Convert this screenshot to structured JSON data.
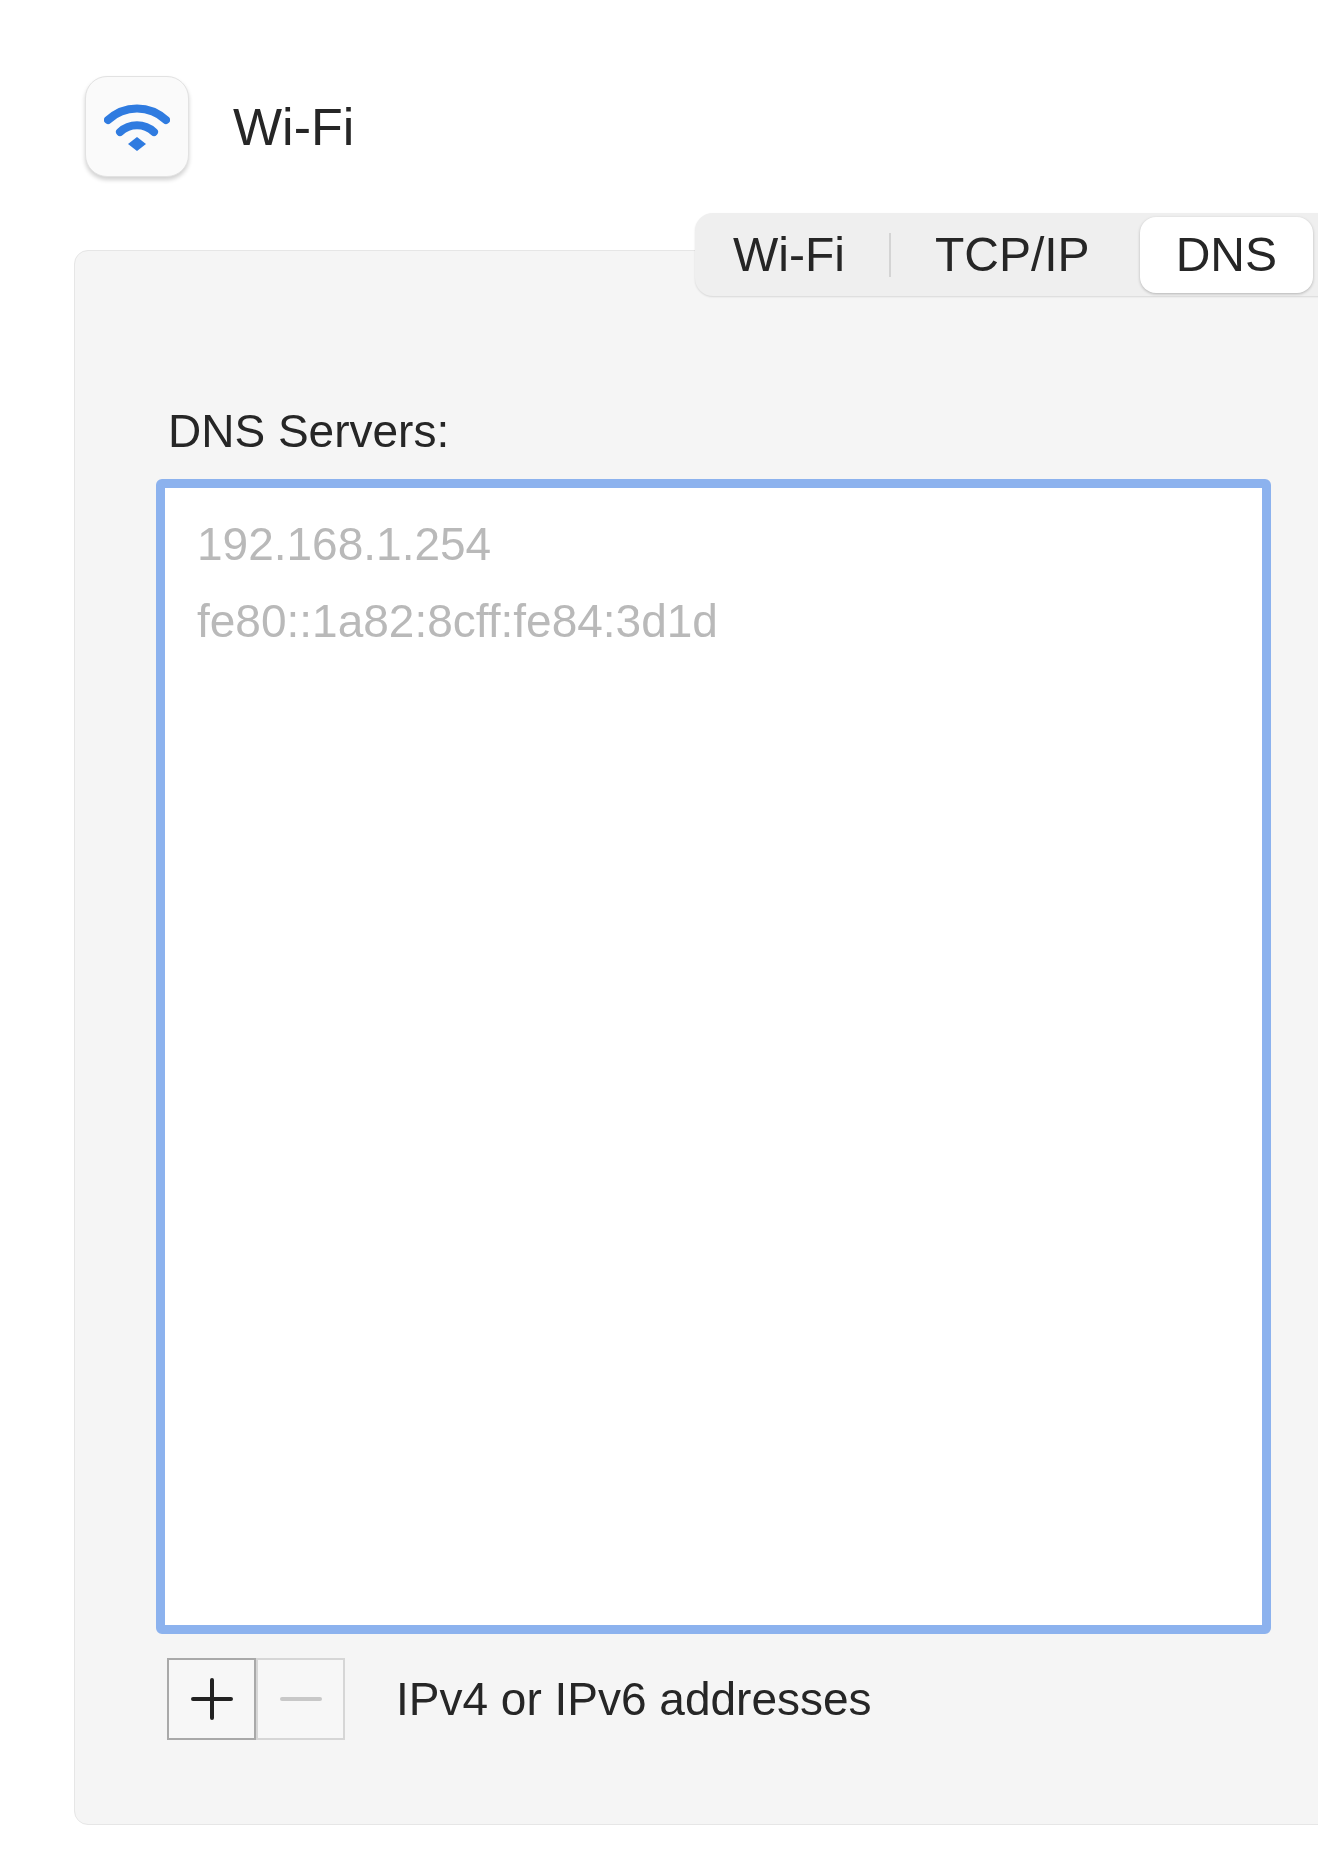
{
  "header": {
    "title": "Wi-Fi"
  },
  "tabs": [
    {
      "label": "Wi-Fi",
      "selected": false
    },
    {
      "label": "TCP/IP",
      "selected": false
    },
    {
      "label": "DNS",
      "selected": true
    }
  ],
  "dns_servers": {
    "label": "DNS Servers:",
    "focused": true,
    "entries": [
      "192.168.1.254",
      "fe80::1a82:8cff:fe84:3d1d"
    ]
  },
  "list_buttons": [
    {
      "kind": "add",
      "disabled": false
    },
    {
      "kind": "remove",
      "disabled": true
    }
  ],
  "hint": "IPv4 or IPv6 addresses"
}
